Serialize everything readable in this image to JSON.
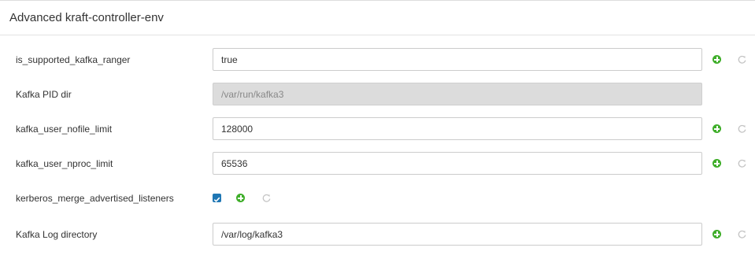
{
  "section": {
    "title": "Advanced kraft-controller-env"
  },
  "colors": {
    "add_icon": "#3fae2a",
    "undo_icon": "#c4c4c4",
    "checkbox": "#1f77b4",
    "disabled_bg": "#dcdcdc"
  },
  "fields": [
    {
      "label": "is_supported_kafka_ranger",
      "value": "true"
    },
    {
      "label": "Kafka PID dir",
      "value": "/var/run/kafka3"
    },
    {
      "label": "kafka_user_nofile_limit",
      "value": "128000"
    },
    {
      "label": "kafka_user_nproc_limit",
      "value": "65536"
    },
    {
      "label": "kerberos_merge_advertised_listeners",
      "checked": true
    },
    {
      "label": "Kafka Log directory",
      "value": "/var/log/kafka3"
    }
  ]
}
